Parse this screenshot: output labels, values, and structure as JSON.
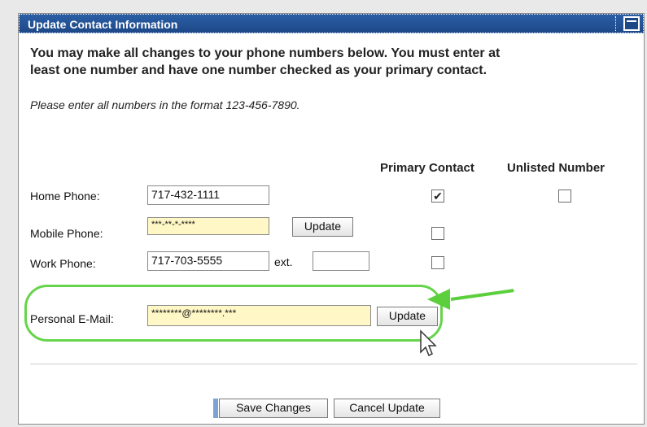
{
  "panel": {
    "title": "Update Contact Information",
    "intro_line1": "You may make all changes to your phone numbers below.  You must enter at",
    "intro_line2": "least one number and have one number checked as your primary contact.",
    "format_hint": "Please enter all numbers in the format 123-456-7890."
  },
  "columns": {
    "primary": "Primary Contact",
    "unlisted": "Unlisted Number"
  },
  "rows": [
    {
      "label": "Home Phone:",
      "value": "717-432-1111",
      "primary_checked": true,
      "unlisted_checked": false
    },
    {
      "label": "Mobile Phone:",
      "value": "***-**-*-****",
      "update_label": "Update",
      "primary_checked": false
    },
    {
      "label": "Work Phone:",
      "value": "717-703-5555",
      "ext_label": "ext.",
      "ext_value": "",
      "primary_checked": false
    }
  ],
  "email": {
    "label": "Personal E-Mail:",
    "value": "********@********.***",
    "update_label": "Update"
  },
  "actions": {
    "save": "Save Changes",
    "cancel": "Cancel Update"
  },
  "colors": {
    "title_bar": "#1d4888",
    "highlight": "#66d44a",
    "masked_field": "#fff8c6"
  },
  "icons": {
    "collapse": "collapse-icon",
    "check": "checkmark-icon",
    "cursor": "mouse-pointer-icon",
    "annotation_arrow": "green-arrow-icon"
  }
}
